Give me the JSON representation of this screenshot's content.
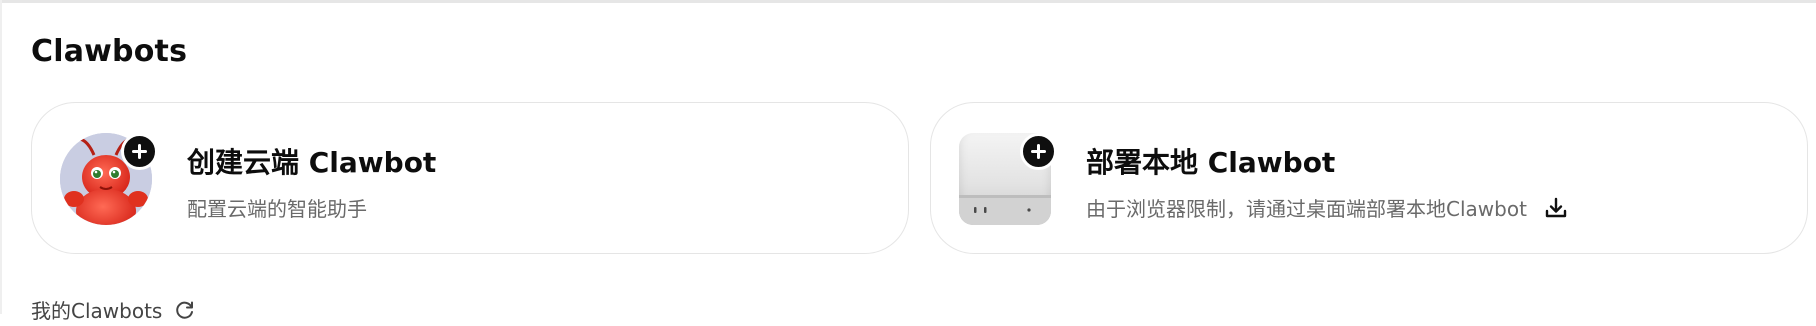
{
  "section": {
    "title": "Clawbots"
  },
  "cards": {
    "cloud": {
      "title": "创建云端 Clawbot",
      "description": "配置云端的智能助手",
      "image_icon": "lobster-avatar",
      "badge_icon": "plus-icon"
    },
    "local": {
      "title": "部署本地 Clawbot",
      "description": "由于浏览器限制，请通过桌面端部署本地Clawbot",
      "image_icon": "mac-mini-device",
      "badge_icon": "plus-icon",
      "action_icon": "download-icon"
    }
  },
  "my_bots": {
    "label": "我的Clawbots",
    "action_icon": "refresh-icon"
  },
  "colors": {
    "text_primary": "#0d0d0d",
    "text_secondary": "#6a6a6a",
    "card_border": "#e5e5e5",
    "badge": "#0f0f0f"
  }
}
